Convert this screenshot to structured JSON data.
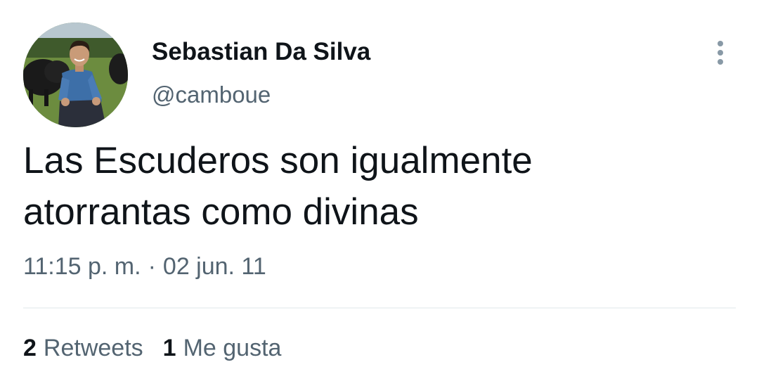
{
  "tweet": {
    "author_name": "Sebastian Da Silva",
    "author_handle": "@camboue",
    "text_lines": [
      "Las Escuderos son igualmente",
      "atorrantas como divinas"
    ],
    "time": "11:15 p. m.",
    "separator": "·",
    "date": "02 jun. 11",
    "retweets_count": "2",
    "retweets_label": "Retweets",
    "likes_count": "1",
    "likes_label": "Me gusta"
  },
  "icons": {
    "more": "more-vertical-icon"
  },
  "colors": {
    "text_primary": "#0f1419",
    "text_secondary": "#536471",
    "divider": "#eff3f4",
    "more_icon": "#8899a6"
  }
}
